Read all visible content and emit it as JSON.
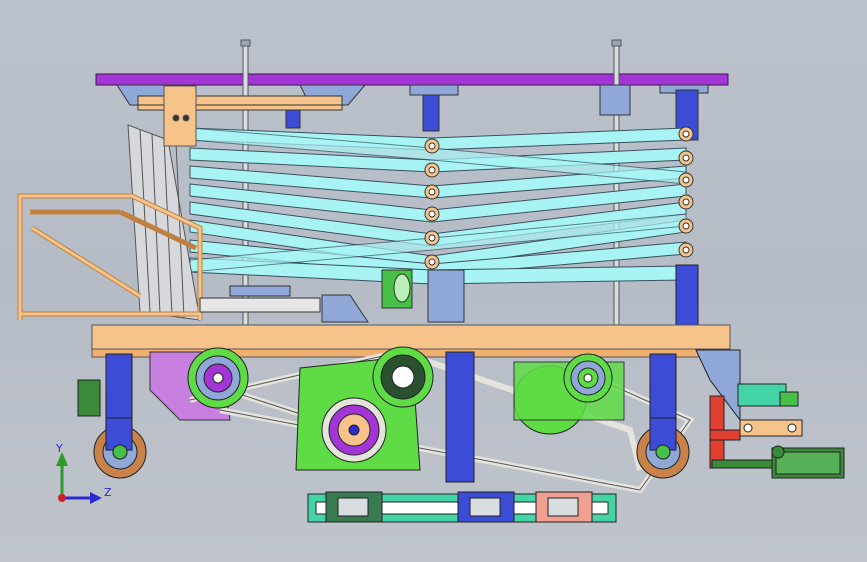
{
  "axes_triad": {
    "y_label": "Y",
    "z_label": "Z"
  },
  "colors": {
    "background": "#bcc2cc",
    "platform_top": "#a334d6",
    "frame_orange": "#f6c48a",
    "scissor_arms": "#a8f4f4",
    "column_blue": "#3c4cd6",
    "gearbox_green": "#5fdc45",
    "wheel_brown": "#c8824a",
    "belt_grey": "#e4e4dc",
    "cylinder_green": "#3a8a3a",
    "bracket_red": "#e04030",
    "rail_teal": "#45d4a8"
  }
}
